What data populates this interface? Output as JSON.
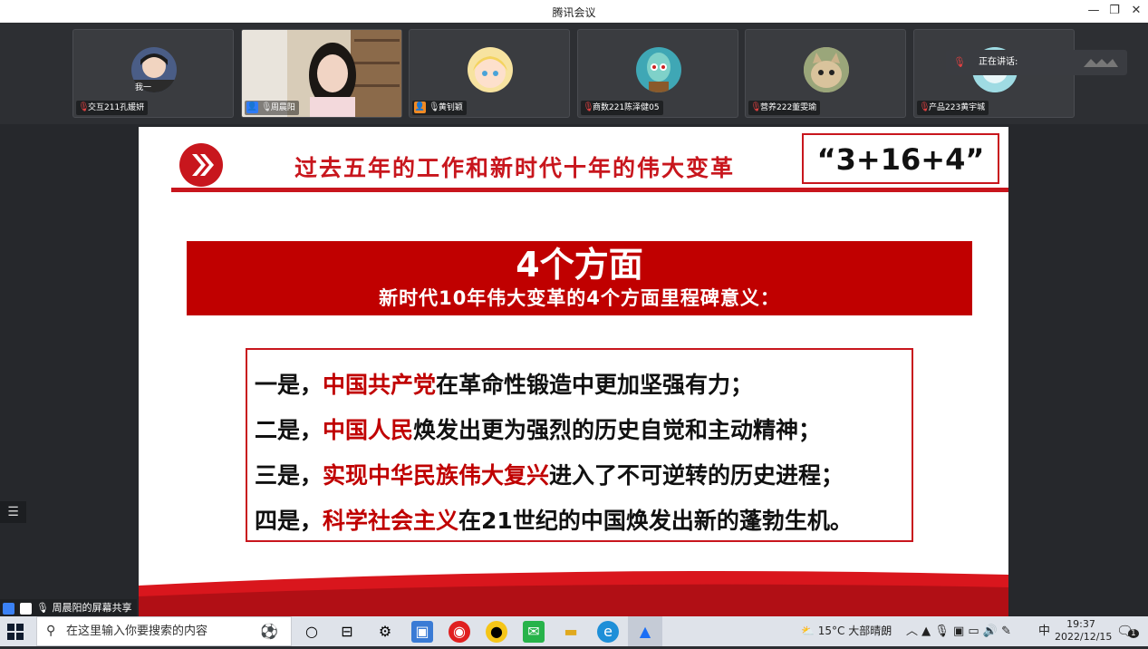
{
  "window": {
    "title": "腾讯会议"
  },
  "participants": [
    {
      "name": "交互211孔媛妍",
      "mic": "muted"
    },
    {
      "name": "周晨阳",
      "mic": "on"
    },
    {
      "name": "黄钊颖",
      "mic": "on"
    },
    {
      "name": "商数221陈泽健05",
      "mic": "muted"
    },
    {
      "name": "营养222董雯瑜",
      "mic": "muted"
    },
    {
      "name": "产品223黄宇城",
      "mic": "muted"
    }
  ],
  "tile_overlay_text": "我一",
  "speaking_label": "正在讲话:",
  "slide": {
    "title": "过去五年的工作和新时代十年的伟大变革",
    "formula": "“3+16+4”",
    "banner_main": "4个方面",
    "banner_sub": "新时代10年伟大变革的4个方面里程碑意义：",
    "points": [
      {
        "prefix": "一是，",
        "highlight": "中国共产党",
        "rest": "在革命性锻造中更加坚强有力；"
      },
      {
        "prefix": "二是，",
        "highlight": "中国人民",
        "rest": "焕发出更为强烈的历史自觉和主动精神；"
      },
      {
        "prefix": "三是，",
        "highlight": "实现中华民族伟大复兴",
        "rest": "进入了不可逆转的历史进程；"
      },
      {
        "prefix": "四是，",
        "highlight": "科学社会主义",
        "rest": "在21世纪的中国焕发出新的蓬勃生机。"
      }
    ]
  },
  "share_tag": "周晨阳的屏幕共享",
  "taskbar": {
    "search_placeholder": "在这里输入你要搜索的内容",
    "weather": "15°C  大部晴朗",
    "ime": "中",
    "time": "19:37",
    "date": "2022/12/15",
    "notification_count": "1"
  },
  "colors": {
    "accent_red": "#c8161d",
    "banner_red": "#c00000"
  }
}
